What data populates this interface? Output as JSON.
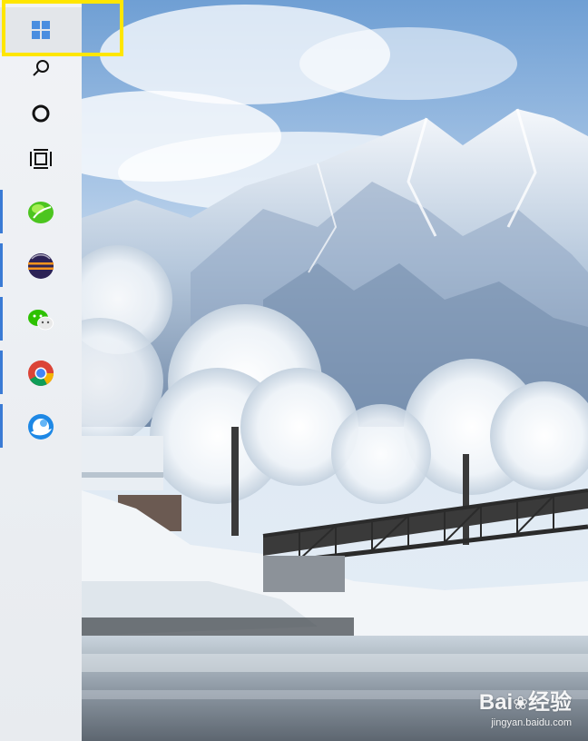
{
  "taskbar": {
    "start": {
      "icon": "windows-logo-icon"
    },
    "search": {
      "icon": "search-icon"
    },
    "cortana": {
      "icon": "cortana-circle-icon"
    },
    "task_view": {
      "icon": "task-view-icon"
    },
    "pinned_apps": [
      {
        "icon": "green-leaf-app-icon",
        "running": true
      },
      {
        "icon": "eclipse-icon",
        "running": true
      },
      {
        "icon": "wechat-icon",
        "running": true
      },
      {
        "icon": "chrome-icon",
        "running": true
      },
      {
        "icon": "blue-swirl-app-icon",
        "running": true
      }
    ]
  },
  "highlight": {
    "color": "#ffe600"
  },
  "watermark": {
    "brand_a": "Bai",
    "brand_b": "经验",
    "url": "jingyan.baidu.com"
  },
  "colors": {
    "accent": "#3a7bd5",
    "sky_top": "#6f9fd4",
    "sky_low": "#cfe0f0"
  }
}
